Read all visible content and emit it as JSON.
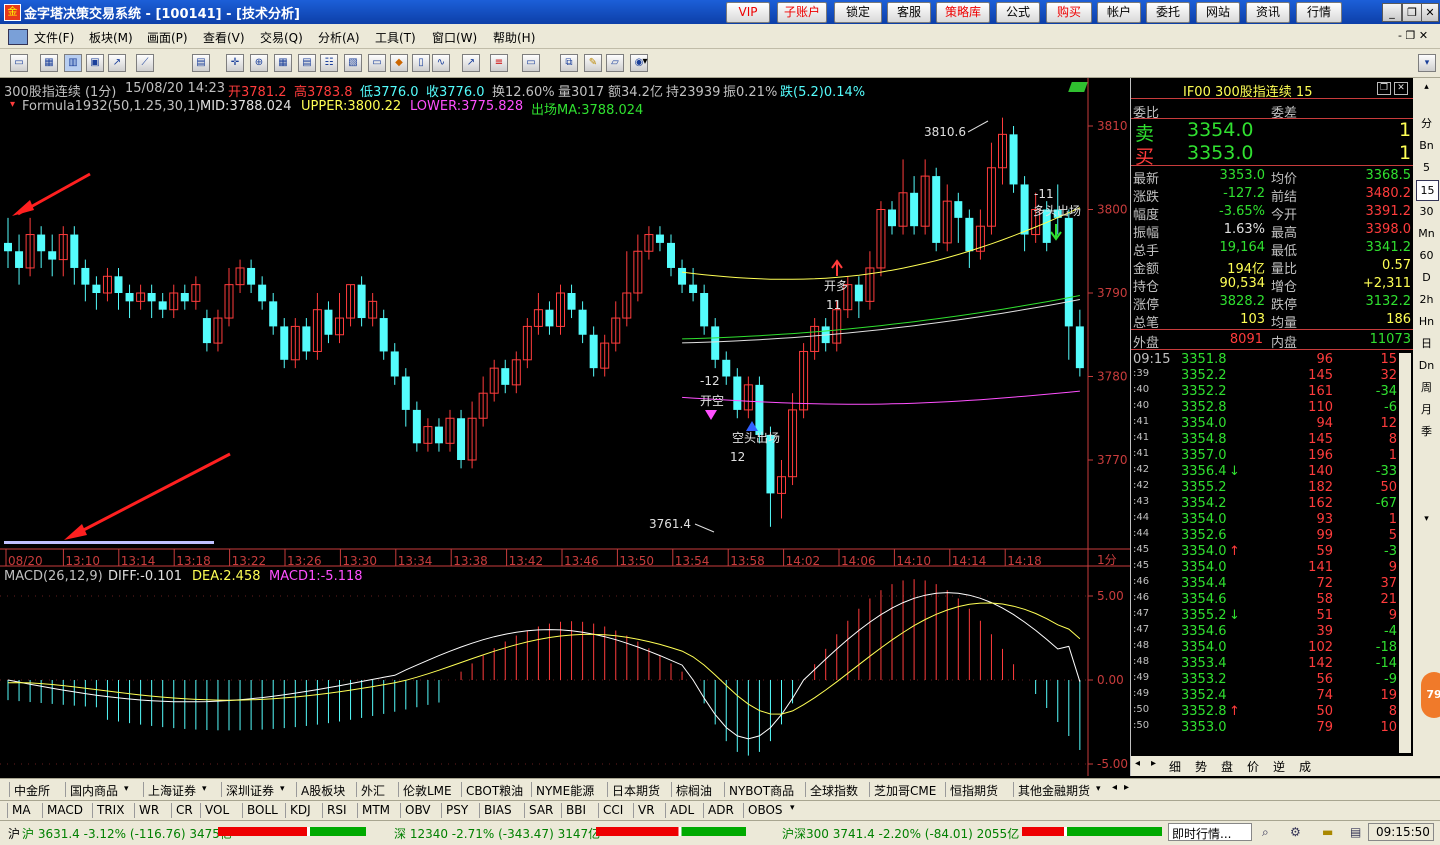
{
  "window": {
    "title": "金字塔决策交易系统 - [100141] - [技术分析]",
    "app_icon": "金",
    "top_buttons": [
      "VIP",
      "子账户",
      "锁定",
      "客服",
      "策略库",
      "公式",
      "购买",
      "帐户",
      "委托",
      "网站",
      "资讯",
      "行情"
    ]
  },
  "menu": [
    "文件(F)",
    "板块(M)",
    "画面(P)",
    "查看(V)",
    "交易(Q)",
    "分析(A)",
    "工具(T)",
    "窗口(W)",
    "帮助(H)"
  ],
  "header": {
    "security": "300股指连续 (1分)",
    "datetime": "15/08/20 14:23",
    "open": "开3781.2",
    "high": "高3783.8",
    "low": "低3776.0",
    "close": "收3776.0",
    "turnover": "换12.60%",
    "volume": "量3017",
    "amount": "额34.2亿",
    "hold": "持23939",
    "swing": "振0.21%",
    "change": "跌(5.2)0.14%"
  },
  "formula": {
    "name": "Formula1932(50,1.25,30,1)",
    "mid": "MID:3788.024",
    "upper": "UPPER:3800.22",
    "lower": "LOWER:3775.828",
    "ma": "出场MA:3788.024"
  },
  "macd_header": {
    "name": "MACD(26,12,9)",
    "diff": "DIFF:-0.101",
    "dea": "DEA:2.458",
    "macd1": "MACD1:-5.118"
  },
  "price_axis": [
    "3810",
    "3800",
    "3790",
    "3780",
    "3770"
  ],
  "macd_axis": [
    "5.00",
    "0.00",
    "-5.00"
  ],
  "time_axis": [
    "08/20",
    "13:10",
    "13:14",
    "13:18",
    "13:22",
    "13:26",
    "13:30",
    "13:34",
    "13:38",
    "13:42",
    "13:46",
    "13:50",
    "13:54",
    "13:58",
    "14:02",
    "14:06",
    "14:10",
    "14:14",
    "14:18"
  ],
  "period_label": "1分",
  "annotations": {
    "high_label": "3810.6",
    "low_label": "3761.4",
    "open_short": "开空",
    "cover_short": "空头出场",
    "open_long": "开多",
    "close_long": "多头出场",
    "n1": "-12",
    "n2": "12",
    "n3": "11",
    "n4": "-11"
  },
  "quote": {
    "title": "IF00  300股指连续  15",
    "weibi_label": "委比",
    "weicha_label": "委差",
    "sell_label": "卖",
    "sell_price": "3354.0",
    "sell_vol": "1",
    "buy_label": "买",
    "buy_price": "3353.0",
    "buy_vol": "1",
    "rows": [
      [
        "最新",
        "3353.0",
        "均价",
        "3368.5"
      ],
      [
        "涨跌",
        "-127.2",
        "前结",
        "3480.2"
      ],
      [
        "幅度",
        "-3.65%",
        "今开",
        "3391.2"
      ],
      [
        "振幅",
        "1.63%",
        "最高",
        "3398.0"
      ],
      [
        "总手",
        "19,164",
        "最低",
        "3341.2"
      ],
      [
        "金额",
        "194亿",
        "量比",
        "0.57"
      ],
      [
        "持仓",
        "90,534",
        "增仓",
        "+2,311"
      ],
      [
        "涨停",
        "3828.2",
        "跌停",
        "3132.2"
      ],
      [
        "总笔",
        "103",
        "均量",
        "186"
      ]
    ],
    "outer_label": "外盘",
    "outer": "8091",
    "inner_label": "内盘",
    "inner": "11073",
    "ticks": [
      [
        "09:15",
        "3351.8",
        "",
        "96",
        "15"
      ],
      [
        ":39",
        "3352.2",
        "",
        "145",
        "32"
      ],
      [
        ":40",
        "3352.2",
        "",
        "161",
        "-34"
      ],
      [
        ":40",
        "3352.8",
        "",
        "110",
        "-6"
      ],
      [
        ":41",
        "3354.0",
        "",
        "94",
        "12"
      ],
      [
        ":41",
        "3354.8",
        "",
        "145",
        "8"
      ],
      [
        ":41",
        "3357.0",
        "",
        "196",
        "1"
      ],
      [
        ":42",
        "3356.4",
        "↓",
        "140",
        "-33"
      ],
      [
        ":42",
        "3355.2",
        "",
        "182",
        "50"
      ],
      [
        ":43",
        "3354.2",
        "",
        "162",
        "-67"
      ],
      [
        ":44",
        "3354.0",
        "",
        "93",
        "1"
      ],
      [
        ":44",
        "3352.6",
        "",
        "99",
        "5"
      ],
      [
        ":45",
        "3354.0",
        "↑",
        "59",
        "-3"
      ],
      [
        ":45",
        "3354.0",
        "",
        "141",
        "9"
      ],
      [
        ":46",
        "3354.4",
        "",
        "72",
        "37"
      ],
      [
        ":46",
        "3354.6",
        "",
        "58",
        "21"
      ],
      [
        ":47",
        "3355.2",
        "↓",
        "51",
        "9"
      ],
      [
        ":47",
        "3354.6",
        "",
        "39",
        "-4"
      ],
      [
        ":48",
        "3354.0",
        "",
        "102",
        "-18"
      ],
      [
        ":48",
        "3353.4",
        "",
        "142",
        "-14"
      ],
      [
        ":49",
        "3353.2",
        "",
        "56",
        "-9"
      ],
      [
        ":49",
        "3352.4",
        "",
        "74",
        "19"
      ],
      [
        ":50",
        "3352.8",
        "↑",
        "50",
        "8"
      ],
      [
        ":50",
        "3353.0",
        "",
        "79",
        "10"
      ]
    ],
    "tabs": [
      "细",
      "势",
      "盘",
      "价",
      "逆",
      "成"
    ]
  },
  "side_tabs": [
    "分",
    "Bn",
    "5",
    "15",
    "30",
    "Mn",
    "60",
    "D",
    "2h",
    "Hn",
    "日",
    "Dn",
    "周",
    "月",
    "季"
  ],
  "market_tabs": [
    "中金所",
    "国内商品",
    "上海证券",
    "深圳证券",
    "A股板块",
    "外汇",
    "伦敦LME",
    "CBOT粮油",
    "NYME能源",
    "日本期货",
    "棕榈油",
    "NYBOT商品",
    "全球指数",
    "芝加哥CME",
    "恒指期货",
    "其他金融期货"
  ],
  "indicator_tabs": [
    "MA",
    "MACD",
    "TRIX",
    "WR",
    "CR",
    "VOL",
    "BOLL",
    "KDJ",
    "RSI",
    "MTM",
    "OBV",
    "PSY",
    "BIAS",
    "SAR",
    "BBI",
    "CCI",
    "VR",
    "ADL",
    "ADR",
    "OBOS"
  ],
  "status": {
    "sh": "沪 3631.4 -3.12% (-116.76) 3475亿",
    "sz": "深 12340 -2.71% (-343.47) 3147亿",
    "hs300": "沪深300  3741.4 -2.20% (-84.01) 2055亿",
    "live": "即时行情...",
    "time": "09:15:50"
  },
  "badge": "79",
  "colors": {
    "up": "#ff3c3c",
    "down": "#54fcfc",
    "yellow": "#ffff55",
    "magenta": "#ff50ff",
    "green": "#30e030",
    "axis": "#c83c3c"
  }
}
